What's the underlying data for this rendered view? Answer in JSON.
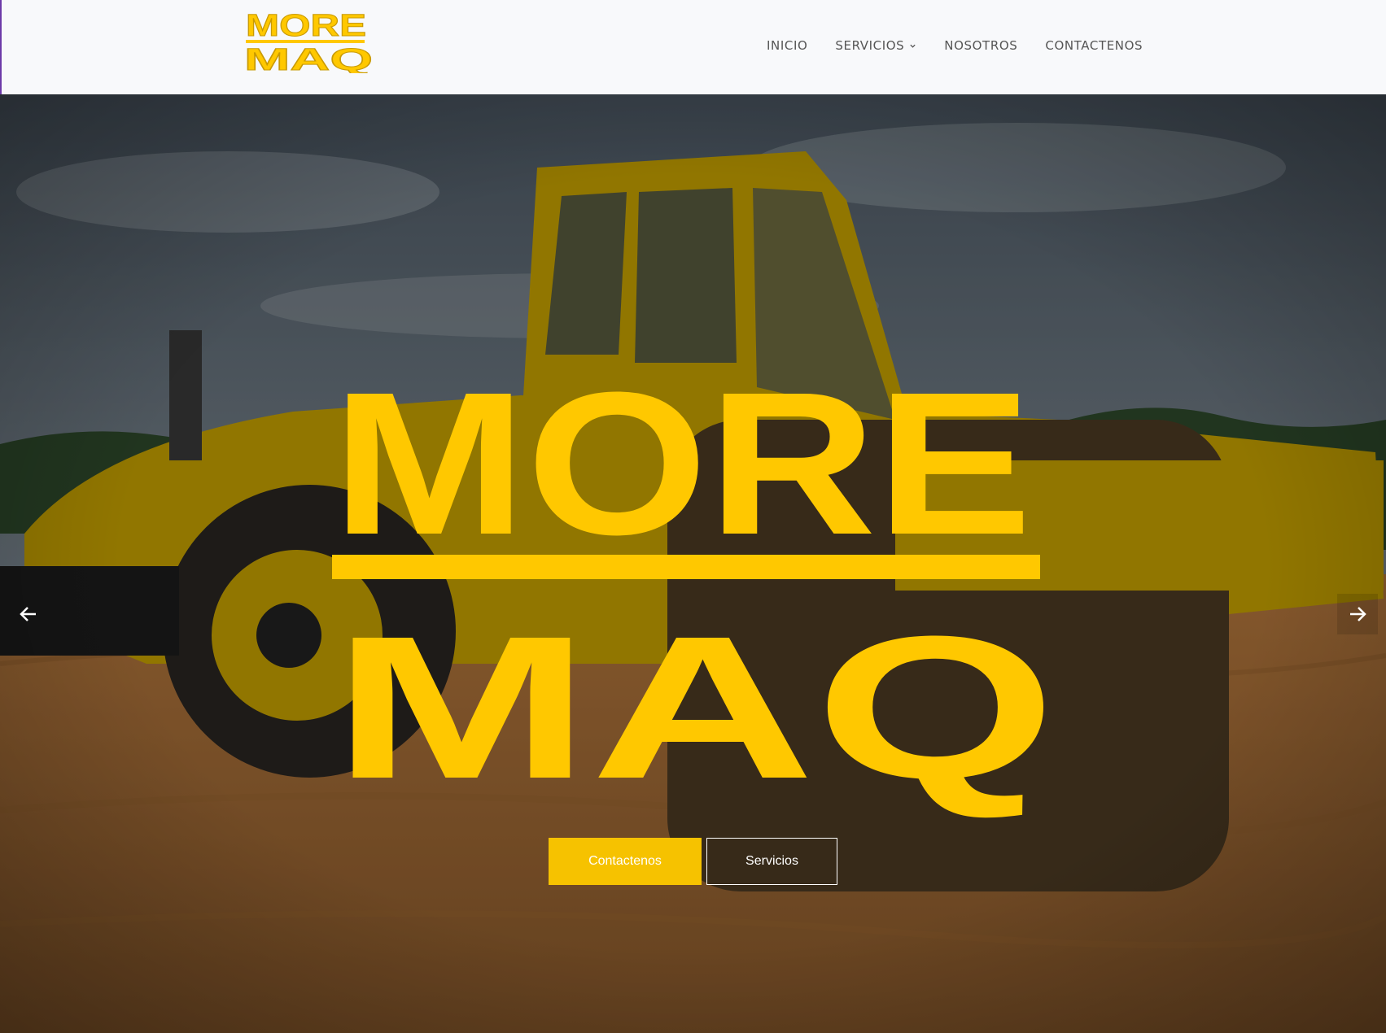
{
  "brand": {
    "name": "MORE MAQ",
    "logo_line1": "MORE",
    "logo_line2": "MAQ",
    "accent_color": "#ffc800",
    "shadow_color": "#b8860b"
  },
  "nav": {
    "items": [
      {
        "label": "INICIO",
        "has_dropdown": false
      },
      {
        "label": "SERVICIOS",
        "has_dropdown": true
      },
      {
        "label": "NOSOTROS",
        "has_dropdown": false
      },
      {
        "label": "CONTACTENOS",
        "has_dropdown": false
      }
    ],
    "text_color": "#555555"
  },
  "hero": {
    "logo_line1": "MORE",
    "logo_line2": "MAQ",
    "primary_button": "Contactenos",
    "secondary_button": "Servicios",
    "prev_icon": "arrow-left-icon",
    "next_icon": "arrow-right-icon"
  }
}
